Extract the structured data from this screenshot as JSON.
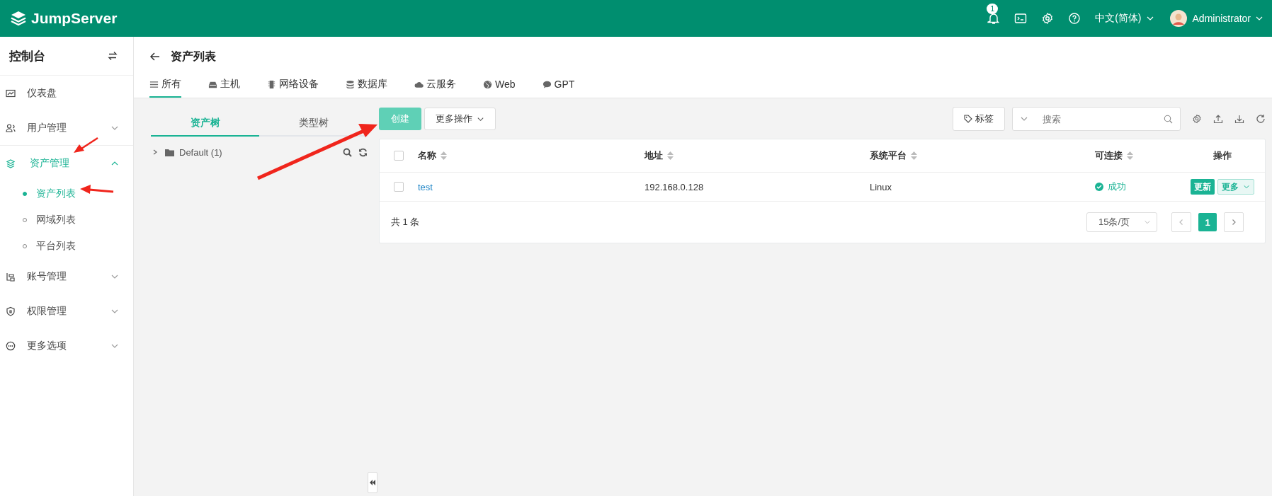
{
  "header": {
    "logo": "JumpServer",
    "notification_count": "1",
    "language": "中文(简体)",
    "user": "Administrator"
  },
  "sidebar": {
    "title": "控制台",
    "items": [
      {
        "label": "仪表盘",
        "kind": "link",
        "selected": false
      },
      {
        "label": "用户管理",
        "kind": "group",
        "expanded": false,
        "selected": false
      },
      {
        "label": "资产管理",
        "kind": "group",
        "expanded": true,
        "selected": true,
        "children": [
          {
            "label": "资产列表",
            "selected": true
          },
          {
            "label": "网域列表",
            "selected": false
          },
          {
            "label": "平台列表",
            "selected": false
          }
        ]
      },
      {
        "label": "账号管理",
        "kind": "group",
        "expanded": false,
        "selected": false
      },
      {
        "label": "权限管理",
        "kind": "group",
        "expanded": false,
        "selected": false
      },
      {
        "label": "更多选项",
        "kind": "group",
        "expanded": false,
        "selected": false
      }
    ]
  },
  "page": {
    "title": "资产列表",
    "tabs": [
      {
        "label": "所有",
        "selected": true
      },
      {
        "label": "主机",
        "selected": false
      },
      {
        "label": "网络设备",
        "selected": false
      },
      {
        "label": "数据库",
        "selected": false
      },
      {
        "label": "云服务",
        "selected": false
      },
      {
        "label": "Web",
        "selected": false
      },
      {
        "label": "GPT",
        "selected": false
      }
    ]
  },
  "tree_panel": {
    "tabs": [
      {
        "label": "资产树",
        "selected": true
      },
      {
        "label": "类型树",
        "selected": false
      }
    ],
    "nodes": [
      {
        "label": "Default (1)",
        "expanded": false
      }
    ]
  },
  "toolbar": {
    "create": "创建",
    "more_actions": "更多操作",
    "tags": "标签",
    "search": {
      "placeholder": "搜索"
    }
  },
  "table": {
    "select_all": {
      "checked": false
    },
    "columns": [
      {
        "label": "名称",
        "sortable": true
      },
      {
        "label": "地址",
        "sortable": true
      },
      {
        "label": "系统平台",
        "sortable": true
      },
      {
        "label": "可连接",
        "sortable": true
      },
      {
        "label": "操作",
        "sortable": false
      }
    ],
    "rows": [
      {
        "checked": false,
        "name": "test",
        "address": "192.168.0.128",
        "platform": "Linux",
        "connectivity": "成功",
        "connected": true,
        "update": "更新",
        "more": "更多"
      }
    ]
  },
  "pagination": {
    "total": "共 1 条",
    "page_size": "15条/页",
    "pages": [
      {
        "label": "1",
        "selected": true
      }
    ]
  }
}
